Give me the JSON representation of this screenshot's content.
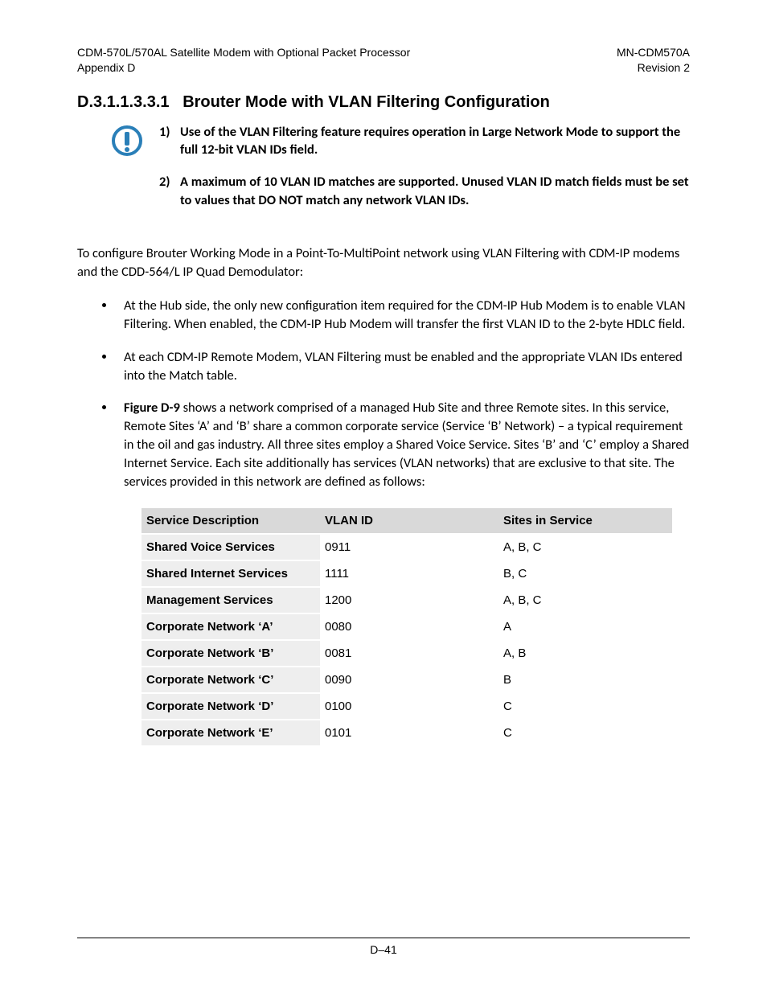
{
  "header": {
    "left_line1": "CDM-570L/570AL Satellite Modem with Optional Packet Processor",
    "left_line2": "Appendix D",
    "right_line1": "MN-CDM570A",
    "right_line2": "Revision 2"
  },
  "section": {
    "number": "D.3.1.1.3.3.1",
    "title": "Brouter Mode with VLAN Filtering Configuration"
  },
  "notes": [
    {
      "num": "1)",
      "text": "Use of the VLAN Filtering feature requires operation in Large Network Mode to support the full 12-bit VLAN IDs field."
    },
    {
      "num": "2)",
      "text": "A maximum of 10 VLAN ID matches are supported. Unused VLAN ID match fields must be set to values that DO NOT match any network VLAN IDs."
    }
  ],
  "intro": "To configure Brouter Working Mode in a Point-To-MultiPoint network using VLAN Filtering with CDM-IP modems and the CDD-564/L IP Quad Demodulator:",
  "bullets": {
    "b1": "At the Hub side, the only new configuration item required for the CDM-IP Hub Modem is to enable VLAN Filtering. When enabled, the CDM-IP Hub Modem will transfer the first VLAN ID to the 2-byte HDLC field.",
    "b2": "At each CDM-IP Remote Modem, VLAN Filtering must be enabled and the appropriate VLAN IDs entered into the Match table.",
    "b3_prefix": "Figure D-9",
    "b3_rest": " shows a network comprised of a managed Hub Site and three Remote sites. In this service, Remote Sites ‘A’ and ‘B’ share a common corporate service (Service ‘B’ Network) – a typical requirement in the oil and gas industry. All three sites employ a Shared Voice Service. Sites ‘B’ and ‘C’ employ a Shared Internet Service. Each site additionally has services (VLAN networks) that are exclusive to that site. The services provided in this network are defined as follows:"
  },
  "table": {
    "headers": {
      "service": "Service Description",
      "vlan": "VLAN ID",
      "sites": "Sites in Service"
    },
    "rows": [
      {
        "service": "Shared Voice Services",
        "vlan": "0911",
        "sites": "A, B, C"
      },
      {
        "service": "Shared Internet Services",
        "vlan": "1111",
        "sites": "B, C"
      },
      {
        "service": "Management Services",
        "vlan": "1200",
        "sites": "A, B, C"
      },
      {
        "service": "Corporate Network ‘A’",
        "vlan": "0080",
        "sites": "A"
      },
      {
        "service": "Corporate Network ‘B’",
        "vlan": "0081",
        "sites": "A, B"
      },
      {
        "service": "Corporate Network ‘C’",
        "vlan": "0090",
        "sites": "B"
      },
      {
        "service": "Corporate Network ‘D’",
        "vlan": "0100",
        "sites": "C"
      },
      {
        "service": "Corporate Network ‘E’",
        "vlan": "0101",
        "sites": "C"
      }
    ]
  },
  "footer": "D–41"
}
